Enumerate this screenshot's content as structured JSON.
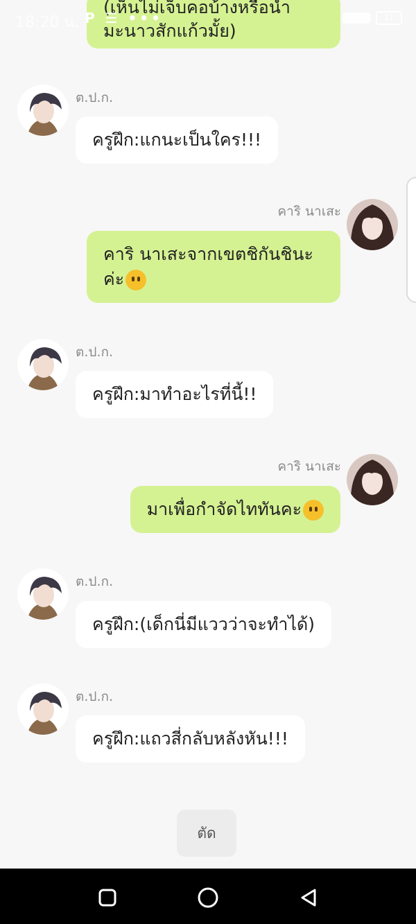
{
  "status_bar": {
    "time": "18:20 น.",
    "icons": "P ☰ •••",
    "battery": "11"
  },
  "messages": [
    {
      "side": "right",
      "sender": "",
      "text": "(เห็นไม่เจ็บคอบ้างหรือน้ำมะนาวสักแก้วมั้ย)"
    },
    {
      "side": "left",
      "sender": "ต.ป.ก.",
      "text": "ครูฝึก:แกนะเป็นใคร!!!"
    },
    {
      "side": "right",
      "sender": "คาริ นาเสะ",
      "text": "คาริ นาเสะจากเขตชิกันชินะค่ะ",
      "emoji": "neutral-face"
    },
    {
      "side": "left",
      "sender": "ต.ป.ก.",
      "text": "ครูฝึก:มาทำอะไรที่นี้!!"
    },
    {
      "side": "right",
      "sender": "คาริ นาเสะ",
      "text": "มาเพื่อกำจัดไททันคะ",
      "emoji": "neutral-face"
    },
    {
      "side": "left",
      "sender": "ต.ป.ก.",
      "text": "ครูฝึก:(เด็กนี่มีแววว่าจะทำได้)"
    },
    {
      "side": "left",
      "sender": "ต.ป.ก.",
      "text": "ครูฝึก:แถวสี่กลับหลังหัน!!!"
    }
  ],
  "actions": {
    "cut_label": "ตัด"
  },
  "nav": {
    "recent": "square-icon",
    "home": "circle-icon",
    "back": "triangle-back-icon"
  },
  "colors": {
    "right_bubble": "#d5f293",
    "left_bubble": "#ffffff",
    "background": "#f7f7f7"
  }
}
